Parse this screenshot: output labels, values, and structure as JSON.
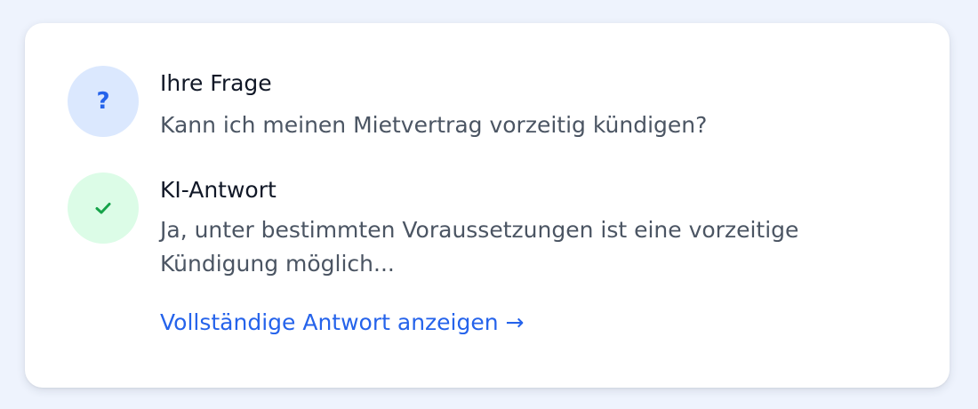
{
  "question": {
    "icon_symbol": "?",
    "icon": "question-mark-icon",
    "title": "Ihre Frage",
    "text": "Kann ich meinen Mietvertrag vorzeitig kündigen?"
  },
  "answer": {
    "icon": "check-icon",
    "title": "KI-Antwort",
    "text": "Ja, unter bestimmten Voraussetzungen ist eine vorzeitige Kündigung möglich...",
    "link_label": "Vollständige Antwort anzeigen →"
  },
  "colors": {
    "page_background": "#eef3fd",
    "card_background": "#ffffff",
    "accent_blue": "#2563eb",
    "question_avatar_bg": "#dbe8fe",
    "answer_avatar_bg": "#dcfce7",
    "check_green": "#16a34a",
    "heading_text": "#111827",
    "body_text": "#4b5563"
  }
}
